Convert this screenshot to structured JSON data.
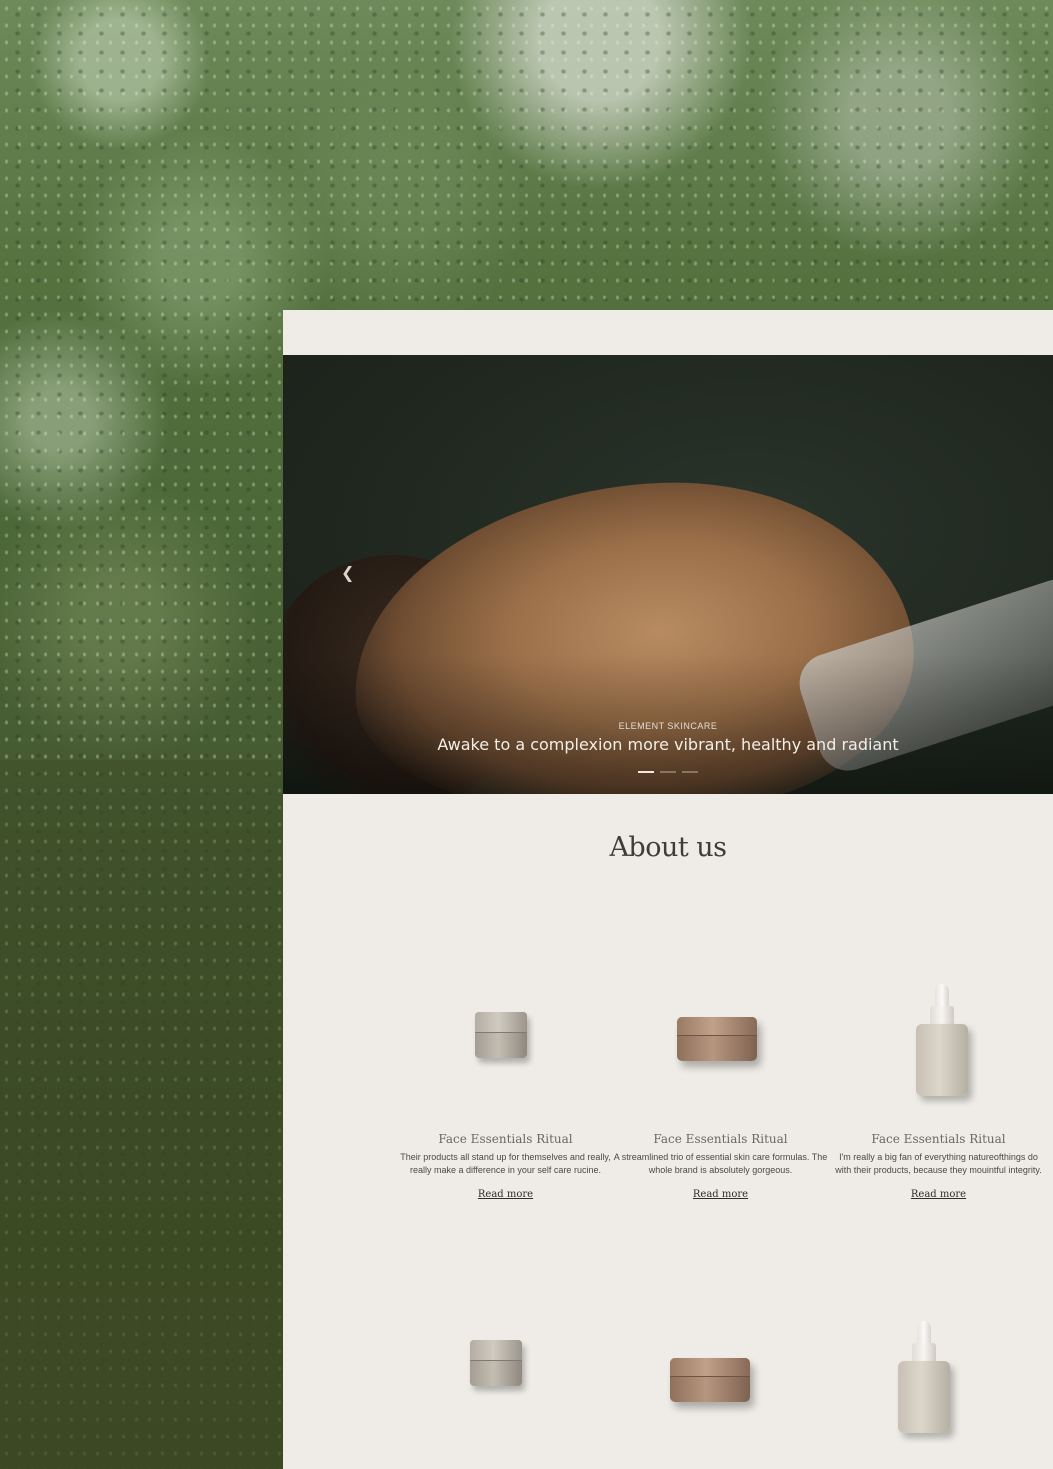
{
  "hero": {
    "prev_icon": "chevron-left-icon",
    "eyebrow": "ELEMENT SKINCARE",
    "title": "Awake to a complexion more vibrant, healthy and radiant",
    "slide_current": 1,
    "slide_count": 3
  },
  "about": {
    "title": "About us"
  },
  "products": [
    {
      "name": "Face Essentials Ritual",
      "text": "Their products all stand up for themselves and really, really make a difference in your self care rucine.",
      "link": "Read more",
      "image": "small-jar"
    },
    {
      "name": "Face Essentials Ritual",
      "text": "A streamlined trio of essential skin care formulas. The whole brand is absolutely gorgeous.",
      "link": "Read more",
      "image": "large-jar"
    },
    {
      "name": "Face Essentials Ritual",
      "text": "I'm really a big fan of everything natureofthings do with their products, because they mouintful integrity.",
      "link": "Read more",
      "image": "dropper-bottle"
    }
  ],
  "products_row2": [
    {
      "image": "small-jar"
    },
    {
      "image": "large-jar"
    },
    {
      "image": "dropper-bottle"
    }
  ]
}
